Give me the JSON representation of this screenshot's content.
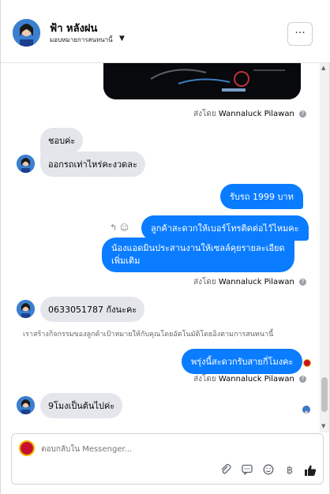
{
  "header": {
    "name": "ฟ้า หลังฝน",
    "subtitle": "มอบหมายการสนทนานี้",
    "more_label": "···"
  },
  "messages": {
    "m1": "ชอบค่ะ",
    "m2": "ออกรถเท่าไหร่คะงวดละ",
    "m3": "รับรถ 1999  บาท",
    "m4": "ลูกค้าสะดวกให้เบอร์โทรติดต่อไว้ไหมคะ",
    "m5_line1": "น้องแอดมินประสานงานให้เซลล์คุยรายละเอียด",
    "m5_line2": "เพิ่มเติม",
    "m6": "0633051787 กังนะคะ",
    "m7": "พรุ่งนี้สะดวกรับสายกี่โมงคะ",
    "m8": "9โมงเป็นต้นไปค่ะ"
  },
  "sent_by": {
    "prefix": "ส่งโดย",
    "name": "Wannaluck Pilawan"
  },
  "system_note": "เราสร้างกิจกรรมของลูกค้าเป้าหมายให้กับคุณโดยอัตโนมัติโดยอิงตามการสนทนานี้",
  "composer": {
    "placeholder": "ตอบกลับใน Messenger...",
    "currency": "฿"
  },
  "icons": [
    "more-icon",
    "reply-icon",
    "emoji-icon",
    "attach-icon",
    "quick-reply-icon",
    "like-icon",
    "info-icon"
  ],
  "colors": {
    "outgoing": "#0a7cff",
    "incoming": "#e4e6eb"
  }
}
